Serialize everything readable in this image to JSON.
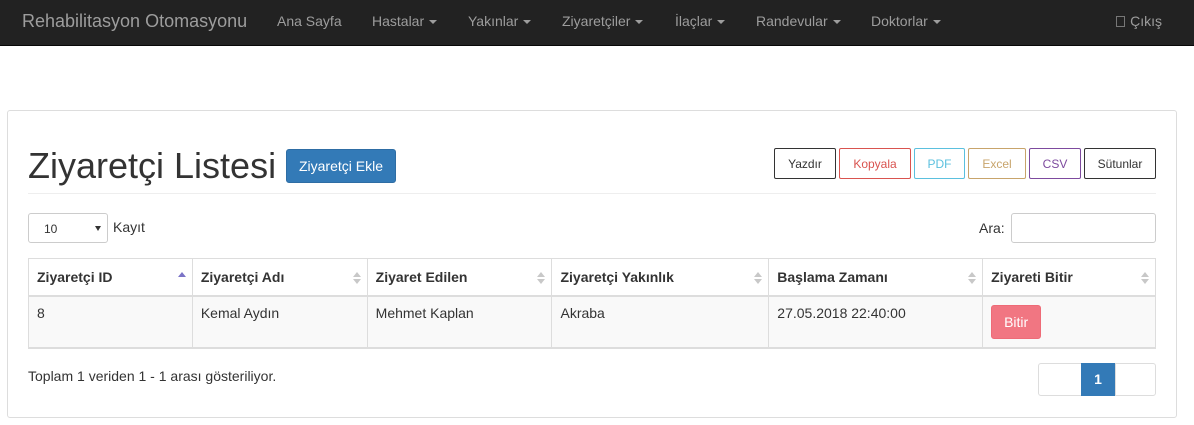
{
  "navbar": {
    "brand": "Rehabilitasyon Otomasyonu",
    "items": [
      {
        "label": "Ana Sayfa"
      },
      {
        "label": "Hastalar"
      },
      {
        "label": "Yakınlar"
      },
      {
        "label": "Ziyaretçiler"
      },
      {
        "label": "İlaçlar"
      },
      {
        "label": "Randevular"
      },
      {
        "label": "Doktorlar"
      }
    ],
    "logout_label": "Çıkış"
  },
  "page": {
    "title": "Ziyaretçi Listesi",
    "add_button": "Ziyaretçi Ekle"
  },
  "export_buttons": [
    {
      "label": "Yazdır",
      "color": "#333333"
    },
    {
      "label": "Kopyala",
      "color": "#d9534f"
    },
    {
      "label": "PDF",
      "color": "#5bc0de"
    },
    {
      "label": "Excel",
      "color": "#c8a46b"
    },
    {
      "label": "CSV",
      "color": "#7d4a9e"
    },
    {
      "label": "Sütunlar",
      "color": "#333333"
    }
  ],
  "length_control": {
    "value": "10",
    "label": "Kayıt"
  },
  "search": {
    "label": "Ara:",
    "value": ""
  },
  "table": {
    "columns": [
      "Ziyaretçi ID",
      "Ziyaretçi Adı",
      "Ziyaret Edilen",
      "Ziyaretçi Yakınlık",
      "Başlama Zamanı",
      "Ziyareti Bitir"
    ],
    "rows": [
      {
        "id": "8",
        "name": "Kemal Aydın",
        "visited": "Mehmet Kaplan",
        "relation": "Akraba",
        "start": "27.05.2018 22:40:00",
        "action": "Bitir"
      }
    ]
  },
  "info_text": "Toplam 1 veriden 1 - 1 arası gösteriliyor.",
  "pagination": {
    "current": "1"
  },
  "colors": {
    "navbar": "#222222",
    "primary": "#337ab7",
    "danger": "#f17682"
  }
}
